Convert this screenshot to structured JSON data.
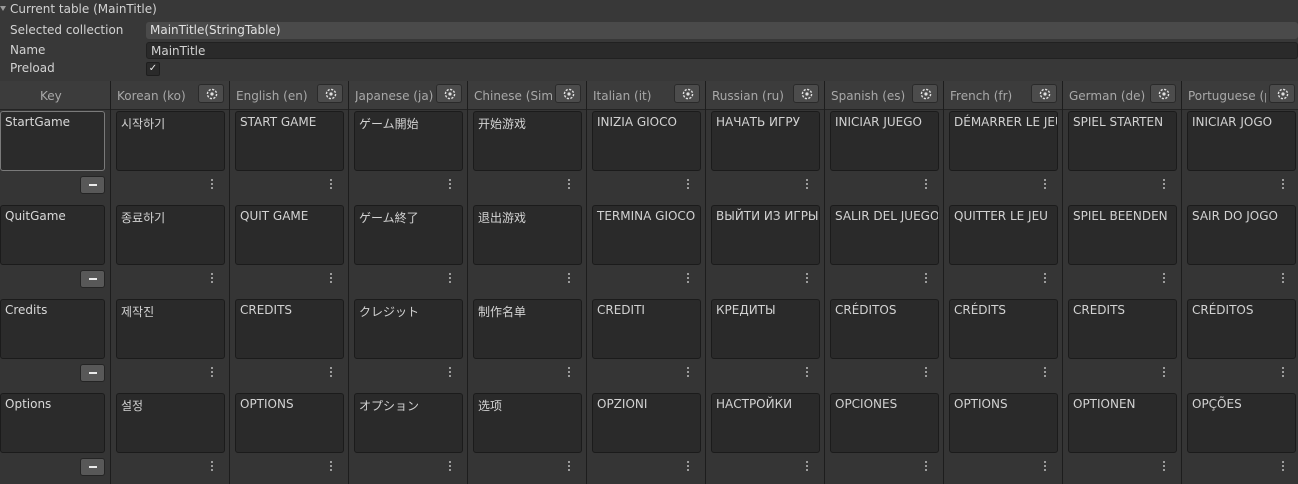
{
  "foldout": {
    "title": "Current table (MainTitle)"
  },
  "properties": {
    "selected_collection": {
      "label": "Selected collection",
      "value": "MainTitle(StringTable)"
    },
    "name": {
      "label": "Name",
      "value": "MainTitle"
    },
    "preload": {
      "label": "Preload",
      "checked": true,
      "check_glyph": "✓"
    }
  },
  "table": {
    "key_header": "Key",
    "columns": [
      "Korean (ko)",
      "English (en)",
      "Japanese (ja)",
      "Chinese (Simplified) (zh-Hans)",
      "Italian (it)",
      "Russian (ru)",
      "Spanish (es)",
      "French (fr)",
      "German (de)",
      "Portuguese (pt)"
    ],
    "rows": [
      {
        "key": "StartGame",
        "values": [
          "시작하기",
          "START GAME",
          "ゲーム開始",
          "开始游戏",
          "INIZIA GIOCO",
          "НАЧАТЬ ИГРУ",
          "INICIAR JUEGO",
          "DÉMARRER LE JEU",
          "SPIEL STARTEN",
          "INICIAR JOGO"
        ]
      },
      {
        "key": "QuitGame",
        "values": [
          "종료하기",
          "QUIT GAME",
          "ゲーム終了",
          "退出游戏",
          "TERMINA GIOCO",
          "ВЫЙТИ ИЗ ИГРЫ",
          "SALIR DEL JUEGO",
          "QUITTER LE JEU",
          "SPIEL BEENDEN",
          "SAIR DO JOGO"
        ]
      },
      {
        "key": "Credits",
        "values": [
          "제작진",
          "CREDITS",
          "クレジット",
          "制作名单",
          "CREDITI",
          "КРЕДИТЫ",
          "CRÉDITOS",
          "CRÉDITS",
          "CREDITS",
          "CRÉDITOS"
        ]
      },
      {
        "key": "Options",
        "values": [
          "설정",
          "OPTIONS",
          "オプション",
          "选项",
          "OPZIONI",
          "НАСТРОЙКИ",
          "OPCIONES",
          "OPTIONS",
          "OPTIONEN",
          "OPÇÕES"
        ]
      }
    ],
    "icons": {
      "locale_settings": "locale-settings-icon",
      "more": "more-vertical-icon",
      "remove": "minus-icon"
    }
  }
}
